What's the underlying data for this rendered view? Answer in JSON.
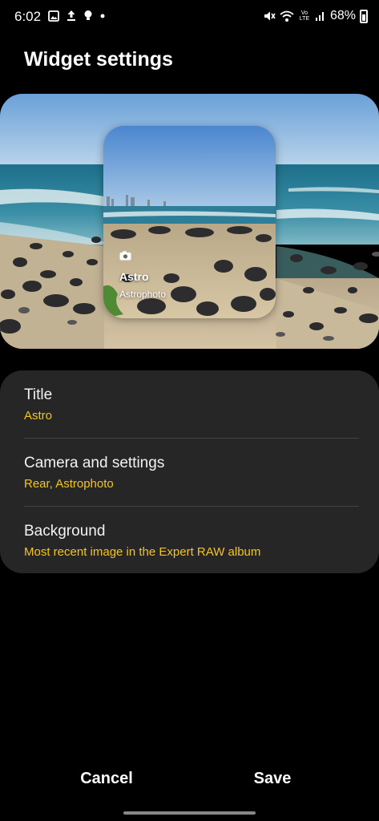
{
  "status_bar": {
    "time": "6:02",
    "battery": "68%",
    "left_icons": [
      "gallery-icon",
      "upload-icon",
      "bulb-icon",
      "dot-icon"
    ],
    "right_icons": [
      "mute-icon",
      "wifi-icon",
      "volte-icon",
      "signal-icon",
      "battery-icon"
    ],
    "volte_label": "Vo LTE"
  },
  "header": {
    "title": "Widget settings"
  },
  "preview": {
    "widget_title": "Astro",
    "widget_subtitle": "Astrophoto"
  },
  "settings": [
    {
      "label": "Title",
      "value": "Astro"
    },
    {
      "label": "Camera and settings",
      "value": "Rear, Astrophoto"
    },
    {
      "label": "Background",
      "value": "Most recent image in the Expert RAW album"
    }
  ],
  "actions": {
    "cancel": "Cancel",
    "save": "Save"
  },
  "colors": {
    "accent": "#f5c518",
    "card_bg": "#262626",
    "page_bg": "#000000"
  }
}
